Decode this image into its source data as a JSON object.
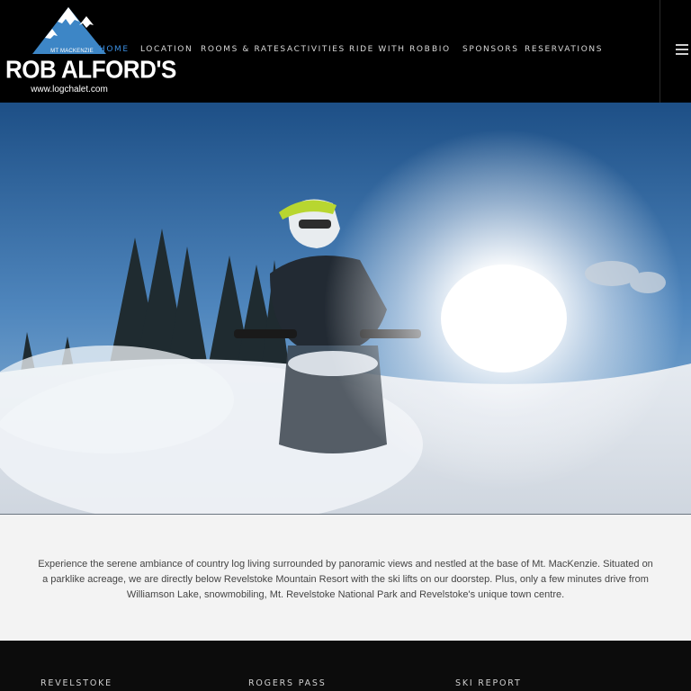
{
  "brand": {
    "tagline": "MT MACKENZIE",
    "name": "ROB ALFORD'S",
    "url": "www.logchalet.com"
  },
  "nav": {
    "items": [
      {
        "label": "HOME",
        "active": true
      },
      {
        "label": "LOCATION",
        "active": false
      },
      {
        "label": "ROOMS & RATES",
        "active": false
      },
      {
        "label": "ACTIVITIES",
        "active": false
      },
      {
        "label": "RIDE WITH ROB",
        "active": false
      },
      {
        "label": "BIO",
        "active": false
      },
      {
        "label": "SPONSORS",
        "active": false
      },
      {
        "label": "RESERVATIONS",
        "active": false
      }
    ],
    "menu_icon": "hamburger-icon"
  },
  "intro": {
    "text": "Experience the serene ambiance of country log living surrounded by panoramic views and nestled at the base of Mt. MacKenzie. Situated on a parklike acreage, we are directly below Revelstoke Mountain Resort with the ski lifts on our doorstep. Plus, only a few minutes drive from Williamson Lake, snowmobiling, Mt. Revelstoke National Park and Revelstoke's unique town centre."
  },
  "footer": {
    "columns": [
      {
        "title": "REVELSTOKE"
      },
      {
        "title": "ROGERS PASS"
      },
      {
        "title": "SKI REPORT"
      }
    ]
  },
  "colors": {
    "accent": "#3b8ee0",
    "header_bg": "#000000",
    "intro_bg": "#f3f3f3",
    "footer_bg": "#0c0c0c"
  }
}
